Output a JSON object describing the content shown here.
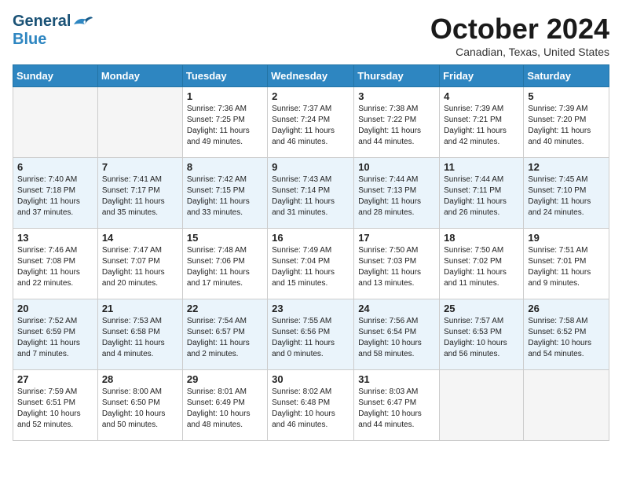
{
  "header": {
    "logo_general": "General",
    "logo_blue": "Blue",
    "month_title": "October 2024",
    "location": "Canadian, Texas, United States"
  },
  "days_of_week": [
    "Sunday",
    "Monday",
    "Tuesday",
    "Wednesday",
    "Thursday",
    "Friday",
    "Saturday"
  ],
  "weeks": [
    [
      {
        "day": "",
        "sunrise": "",
        "sunset": "",
        "daylight": ""
      },
      {
        "day": "",
        "sunrise": "",
        "sunset": "",
        "daylight": ""
      },
      {
        "day": "1",
        "sunrise": "Sunrise: 7:36 AM",
        "sunset": "Sunset: 7:25 PM",
        "daylight": "Daylight: 11 hours and 49 minutes."
      },
      {
        "day": "2",
        "sunrise": "Sunrise: 7:37 AM",
        "sunset": "Sunset: 7:24 PM",
        "daylight": "Daylight: 11 hours and 46 minutes."
      },
      {
        "day": "3",
        "sunrise": "Sunrise: 7:38 AM",
        "sunset": "Sunset: 7:22 PM",
        "daylight": "Daylight: 11 hours and 44 minutes."
      },
      {
        "day": "4",
        "sunrise": "Sunrise: 7:39 AM",
        "sunset": "Sunset: 7:21 PM",
        "daylight": "Daylight: 11 hours and 42 minutes."
      },
      {
        "day": "5",
        "sunrise": "Sunrise: 7:39 AM",
        "sunset": "Sunset: 7:20 PM",
        "daylight": "Daylight: 11 hours and 40 minutes."
      }
    ],
    [
      {
        "day": "6",
        "sunrise": "Sunrise: 7:40 AM",
        "sunset": "Sunset: 7:18 PM",
        "daylight": "Daylight: 11 hours and 37 minutes."
      },
      {
        "day": "7",
        "sunrise": "Sunrise: 7:41 AM",
        "sunset": "Sunset: 7:17 PM",
        "daylight": "Daylight: 11 hours and 35 minutes."
      },
      {
        "day": "8",
        "sunrise": "Sunrise: 7:42 AM",
        "sunset": "Sunset: 7:15 PM",
        "daylight": "Daylight: 11 hours and 33 minutes."
      },
      {
        "day": "9",
        "sunrise": "Sunrise: 7:43 AM",
        "sunset": "Sunset: 7:14 PM",
        "daylight": "Daylight: 11 hours and 31 minutes."
      },
      {
        "day": "10",
        "sunrise": "Sunrise: 7:44 AM",
        "sunset": "Sunset: 7:13 PM",
        "daylight": "Daylight: 11 hours and 28 minutes."
      },
      {
        "day": "11",
        "sunrise": "Sunrise: 7:44 AM",
        "sunset": "Sunset: 7:11 PM",
        "daylight": "Daylight: 11 hours and 26 minutes."
      },
      {
        "day": "12",
        "sunrise": "Sunrise: 7:45 AM",
        "sunset": "Sunset: 7:10 PM",
        "daylight": "Daylight: 11 hours and 24 minutes."
      }
    ],
    [
      {
        "day": "13",
        "sunrise": "Sunrise: 7:46 AM",
        "sunset": "Sunset: 7:08 PM",
        "daylight": "Daylight: 11 hours and 22 minutes."
      },
      {
        "day": "14",
        "sunrise": "Sunrise: 7:47 AM",
        "sunset": "Sunset: 7:07 PM",
        "daylight": "Daylight: 11 hours and 20 minutes."
      },
      {
        "day": "15",
        "sunrise": "Sunrise: 7:48 AM",
        "sunset": "Sunset: 7:06 PM",
        "daylight": "Daylight: 11 hours and 17 minutes."
      },
      {
        "day": "16",
        "sunrise": "Sunrise: 7:49 AM",
        "sunset": "Sunset: 7:04 PM",
        "daylight": "Daylight: 11 hours and 15 minutes."
      },
      {
        "day": "17",
        "sunrise": "Sunrise: 7:50 AM",
        "sunset": "Sunset: 7:03 PM",
        "daylight": "Daylight: 11 hours and 13 minutes."
      },
      {
        "day": "18",
        "sunrise": "Sunrise: 7:50 AM",
        "sunset": "Sunset: 7:02 PM",
        "daylight": "Daylight: 11 hours and 11 minutes."
      },
      {
        "day": "19",
        "sunrise": "Sunrise: 7:51 AM",
        "sunset": "Sunset: 7:01 PM",
        "daylight": "Daylight: 11 hours and 9 minutes."
      }
    ],
    [
      {
        "day": "20",
        "sunrise": "Sunrise: 7:52 AM",
        "sunset": "Sunset: 6:59 PM",
        "daylight": "Daylight: 11 hours and 7 minutes."
      },
      {
        "day": "21",
        "sunrise": "Sunrise: 7:53 AM",
        "sunset": "Sunset: 6:58 PM",
        "daylight": "Daylight: 11 hours and 4 minutes."
      },
      {
        "day": "22",
        "sunrise": "Sunrise: 7:54 AM",
        "sunset": "Sunset: 6:57 PM",
        "daylight": "Daylight: 11 hours and 2 minutes."
      },
      {
        "day": "23",
        "sunrise": "Sunrise: 7:55 AM",
        "sunset": "Sunset: 6:56 PM",
        "daylight": "Daylight: 11 hours and 0 minutes."
      },
      {
        "day": "24",
        "sunrise": "Sunrise: 7:56 AM",
        "sunset": "Sunset: 6:54 PM",
        "daylight": "Daylight: 10 hours and 58 minutes."
      },
      {
        "day": "25",
        "sunrise": "Sunrise: 7:57 AM",
        "sunset": "Sunset: 6:53 PM",
        "daylight": "Daylight: 10 hours and 56 minutes."
      },
      {
        "day": "26",
        "sunrise": "Sunrise: 7:58 AM",
        "sunset": "Sunset: 6:52 PM",
        "daylight": "Daylight: 10 hours and 54 minutes."
      }
    ],
    [
      {
        "day": "27",
        "sunrise": "Sunrise: 7:59 AM",
        "sunset": "Sunset: 6:51 PM",
        "daylight": "Daylight: 10 hours and 52 minutes."
      },
      {
        "day": "28",
        "sunrise": "Sunrise: 8:00 AM",
        "sunset": "Sunset: 6:50 PM",
        "daylight": "Daylight: 10 hours and 50 minutes."
      },
      {
        "day": "29",
        "sunrise": "Sunrise: 8:01 AM",
        "sunset": "Sunset: 6:49 PM",
        "daylight": "Daylight: 10 hours and 48 minutes."
      },
      {
        "day": "30",
        "sunrise": "Sunrise: 8:02 AM",
        "sunset": "Sunset: 6:48 PM",
        "daylight": "Daylight: 10 hours and 46 minutes."
      },
      {
        "day": "31",
        "sunrise": "Sunrise: 8:03 AM",
        "sunset": "Sunset: 6:47 PM",
        "daylight": "Daylight: 10 hours and 44 minutes."
      },
      {
        "day": "",
        "sunrise": "",
        "sunset": "",
        "daylight": ""
      },
      {
        "day": "",
        "sunrise": "",
        "sunset": "",
        "daylight": ""
      }
    ]
  ]
}
